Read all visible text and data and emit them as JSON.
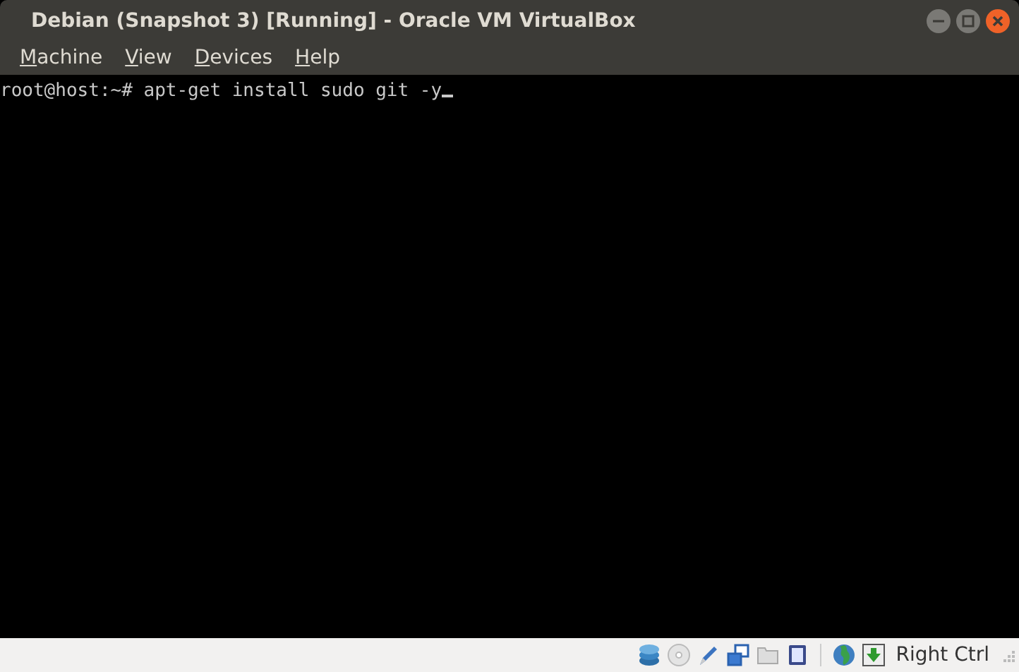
{
  "window": {
    "title": "Debian (Snapshot 3) [Running] - Oracle VM VirtualBox"
  },
  "menu": [
    "Machine",
    "View",
    "Devices",
    "Help"
  ],
  "terminal": {
    "lines": [
      "root@host:~# apt-get install sudo git -y"
    ]
  },
  "status_bar": {
    "host_key": "Right Ctrl"
  }
}
